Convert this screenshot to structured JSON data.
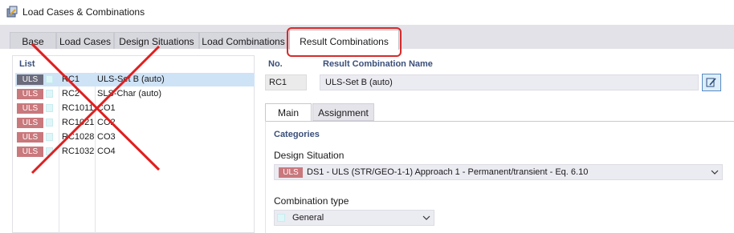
{
  "window": {
    "title": "Load Cases & Combinations"
  },
  "tabs": [
    {
      "label": "Base"
    },
    {
      "label": "Load Cases"
    },
    {
      "label": "Design Situations"
    },
    {
      "label": "Load Combinations"
    },
    {
      "label": "Result Combinations"
    }
  ],
  "list": {
    "header": "List",
    "rows": [
      {
        "badge": "ULS",
        "no": "RC1",
        "name": "ULS-Set B (auto)"
      },
      {
        "badge": "ULS",
        "no": "RC2",
        "name": "SLS-Char (auto)"
      },
      {
        "badge": "ULS",
        "no": "RC1011",
        "name": "CO1"
      },
      {
        "badge": "ULS",
        "no": "RC1021",
        "name": "CO2"
      },
      {
        "badge": "ULS",
        "no": "RC1028",
        "name": "CO3"
      },
      {
        "badge": "ULS",
        "no": "RC1032",
        "name": "CO4"
      }
    ]
  },
  "detail": {
    "no_label": "No.",
    "no_value": "RC1",
    "name_label": "Result Combination Name",
    "name_value": "ULS-Set B (auto)",
    "subtabs": {
      "main": "Main",
      "assignment": "Assignment"
    },
    "categories": "Categories",
    "design_situation_label": "Design Situation",
    "design_situation_badge": "ULS",
    "design_situation_value": "DS1 - ULS (STR/GEO-1-1) Approach 1 - Permanent/transient - Eq. 6.10",
    "combination_type_label": "Combination type",
    "combination_type_value": "General"
  },
  "colors": {
    "highlight": "#d62a2a",
    "badge_uls": "#c9787c",
    "selected_row": "#cfe3f7",
    "heading": "#3a4f7a"
  }
}
